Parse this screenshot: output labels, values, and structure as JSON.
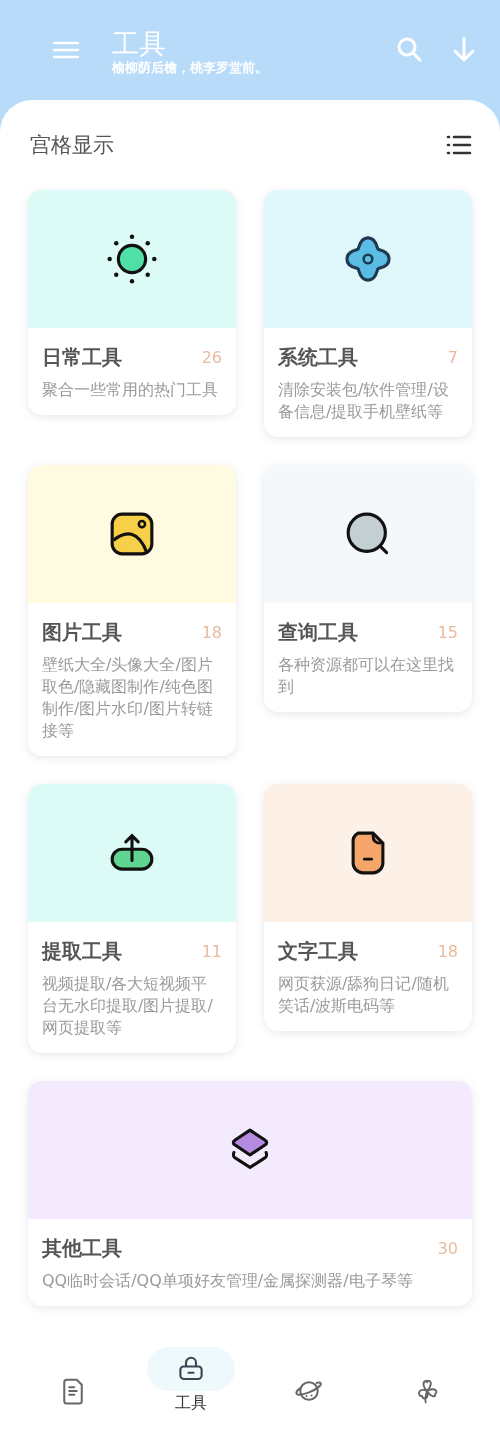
{
  "header": {
    "title": "工具",
    "subtitle": "榆柳荫后檐，桃李罗堂前。"
  },
  "section": {
    "title": "宫格显示"
  },
  "cards": [
    {
      "kind": "sun",
      "color": "#dcfbf6",
      "title": "日常工具",
      "count": "26",
      "description": "聚合一些常用的热门工具",
      "wide": false
    },
    {
      "kind": "flower",
      "color": "#e0f7fb",
      "title": "系统工具",
      "count": "7",
      "description": "清除安装包/软件管理/设备信息/提取手机壁纸等",
      "wide": false
    },
    {
      "kind": "image",
      "color": "#fefbe0",
      "title": "图片工具",
      "count": "18",
      "description": "壁纸大全/头像大全/图片取色/隐藏图制作/纯色图制作/图片水印/图片转链接等",
      "wide": false
    },
    {
      "kind": "search",
      "color": "#f4f8fb",
      "title": "查询工具",
      "count": "15",
      "description": "各种资源都可以在这里找到",
      "wide": false
    },
    {
      "kind": "upload",
      "color": "#dcfbf6",
      "title": "提取工具",
      "count": "11",
      "description": "视频提取/各大短视频平台无水印提取/图片提取/网页提取等",
      "wide": false
    },
    {
      "kind": "file",
      "color": "#fdf0e6",
      "title": "文字工具",
      "count": "18",
      "description": "网页获源/舔狗日记/随机笑话/波斯电码等",
      "wide": false
    },
    {
      "kind": "layers",
      "color": "#f3ebfd",
      "title": "其他工具",
      "count": "30",
      "description": "QQ临时会话/QQ单项好友管理/金属探测器/电子琴等",
      "wide": true
    }
  ],
  "bottom_nav": [
    {
      "kind": "document",
      "selected": false
    },
    {
      "kind": "lock",
      "selected": true,
      "label": "工具"
    },
    {
      "kind": "planet",
      "selected": false
    },
    {
      "kind": "clover",
      "selected": false
    }
  ]
}
